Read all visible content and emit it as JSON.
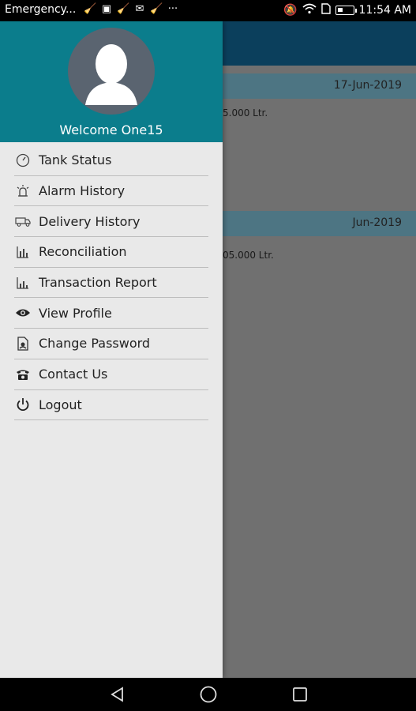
{
  "status_bar": {
    "carrier": "Emergency...",
    "more": "···",
    "time": "11:54 AM",
    "battery_level": 0.35
  },
  "app_background": {
    "cards": [
      {
        "date": "17-Jun-2019",
        "line": "5.000 Ltr."
      },
      {
        "date": "Jun-2019",
        "line": "05.000 Ltr."
      }
    ]
  },
  "drawer": {
    "welcome_text": "Welcome One15",
    "menu": [
      {
        "label": "Tank Status",
        "icon": "gauge-icon"
      },
      {
        "label": "Alarm History",
        "icon": "alarm-icon"
      },
      {
        "label": "Delivery History",
        "icon": "truck-icon"
      },
      {
        "label": "Reconciliation",
        "icon": "bar-chart-icon"
      },
      {
        "label": "Transaction Report",
        "icon": "report-chart-icon"
      },
      {
        "label": "View Profile",
        "icon": "eye-icon"
      },
      {
        "label": "Change Password",
        "icon": "password-icon"
      },
      {
        "label": "Contact Us",
        "icon": "phone-icon"
      },
      {
        "label": "Logout",
        "icon": "power-icon"
      }
    ]
  },
  "colors": {
    "drawer_header": "#0b7d8c",
    "drawer_bg": "#e9e9e9",
    "app_header": "#0b3f5c",
    "card_header": "#4d7583"
  }
}
